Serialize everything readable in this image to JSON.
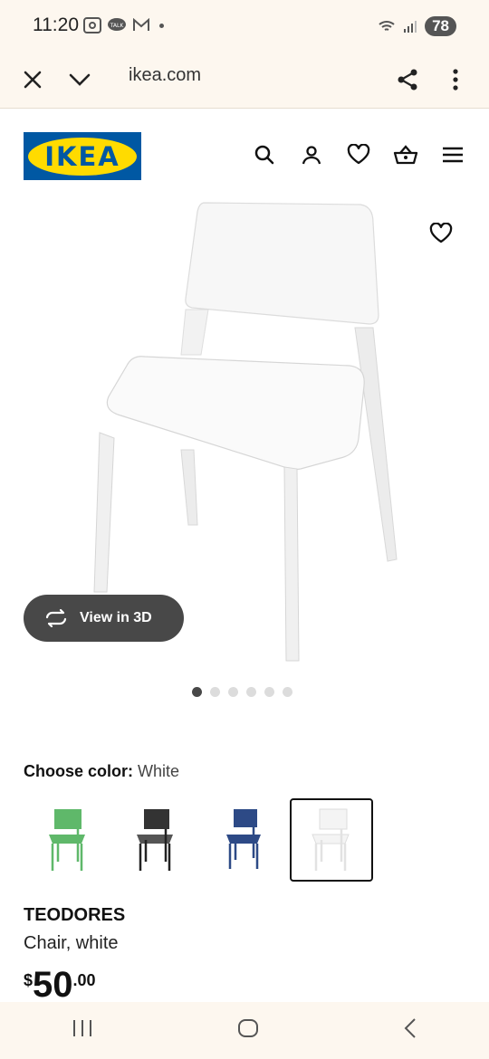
{
  "status": {
    "time": "11:20",
    "battery": "78"
  },
  "browser": {
    "url": "ikea.com"
  },
  "brand": {
    "logo_text": "IKEA",
    "primary_color": "#0058a3",
    "accent_color": "#ffdb00"
  },
  "header_icons": [
    "search-icon",
    "account-icon",
    "heart-icon",
    "basket-icon",
    "menu-icon"
  ],
  "view3d": {
    "label": "View in 3D"
  },
  "carousel": {
    "count": 6,
    "active": 0
  },
  "color_picker": {
    "label": "Choose color:",
    "selected": "White",
    "options": [
      {
        "name": "Green",
        "hex": "#5fb86a"
      },
      {
        "name": "Black",
        "hex": "#333333"
      },
      {
        "name": "Blue",
        "hex": "#2d4a86"
      },
      {
        "name": "White",
        "hex": "#f4f4f4"
      }
    ]
  },
  "product": {
    "name": "TEODORES",
    "description": "Chair, white",
    "price_currency": "$",
    "price_integer": "50",
    "price_decimal": ".00"
  }
}
